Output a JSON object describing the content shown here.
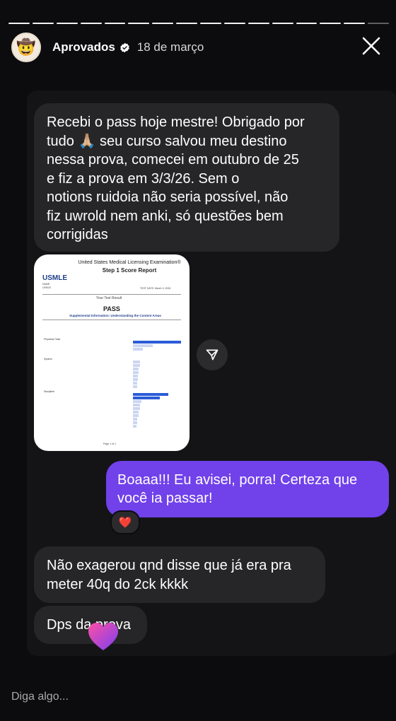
{
  "story": {
    "segments_total": 16,
    "segments_done": 15,
    "username": "Aprovados",
    "date": "18 de março",
    "avatar_icon": "cowboy-hat-icon",
    "verified_color": "#ffffff"
  },
  "messages": {
    "received_1": "Recebi o pass hoje mestre! Obrigado por\ntudo 🙏🏼 seu curso salvou meu destino\nnessa prova, comecei em outubro de 25\ne fiz a prova em 3/3/26. Sem o\nnotions ruidoia não seria possível, não\nfiz uwrold nem anki, só questões bem\ncorrigidas",
    "sent_1": "Boaaa!!! Eu avisei, porra! Certeza que você ia passar!",
    "sent_1_reaction": "❤️",
    "received_2": "Não exagerou qnd disse que já era pra meter 40q do 2ck kkkk",
    "received_3": "Dps da prova"
  },
  "report": {
    "header_line1": "United States Medical Licensing Examination®",
    "header_line2": "Step 1 Score Report",
    "logo": "USMLE",
    "result": "PASS",
    "section": "Supplemental Information: Understanding the Content Areas",
    "test_date": "TEST DATE: March 3, 2026",
    "your_result": "Your Test Result",
    "footer": "Page 1 of 1",
    "name_label": "NAME:",
    "usmle_label": "USMLE"
  },
  "input": {
    "placeholder": "Diga algo..."
  },
  "colors": {
    "sent_bubble": "#7141ea",
    "received_bubble": "#262629",
    "background": "#0c0c0f"
  }
}
